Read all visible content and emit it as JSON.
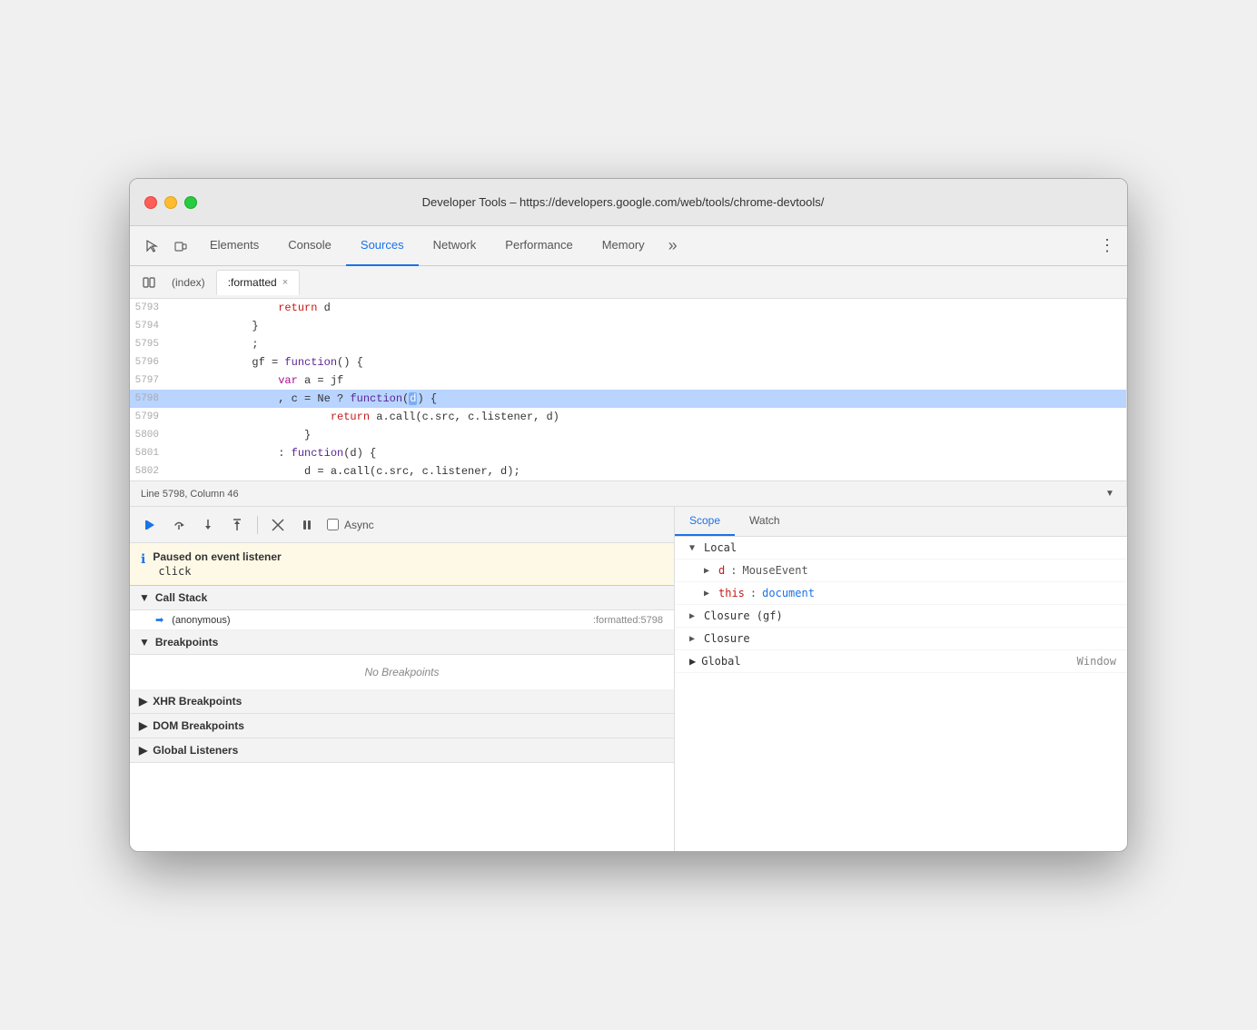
{
  "window": {
    "title": "Developer Tools – https://developers.google.com/web/tools/chrome-devtools/"
  },
  "tabs": {
    "items": [
      {
        "label": "Elements",
        "active": false
      },
      {
        "label": "Console",
        "active": false
      },
      {
        "label": "Sources",
        "active": true
      },
      {
        "label": "Network",
        "active": false
      },
      {
        "label": "Performance",
        "active": false
      },
      {
        "label": "Memory",
        "active": false
      }
    ],
    "more_label": "»",
    "menu_label": "⋮"
  },
  "file_tabs": {
    "index_label": "(index)",
    "formatted_label": ":formatted",
    "close_label": "×"
  },
  "code": {
    "lines": [
      {
        "num": "5793",
        "text": "                return d"
      },
      {
        "num": "5794",
        "text": "            }"
      },
      {
        "num": "5795",
        "text": "            ;"
      },
      {
        "num": "5796",
        "text": "            gf = function() {"
      },
      {
        "num": "5797",
        "text": "                var a = jf"
      },
      {
        "num": "5798",
        "text": "                , c = Ne ? function(d) {",
        "highlighted": true
      },
      {
        "num": "5799",
        "text": "                        return a.call(c.src, c.listener, d)"
      },
      {
        "num": "5800",
        "text": "                    }"
      },
      {
        "num": "5801",
        "text": "                : function(d) {"
      },
      {
        "num": "5802",
        "text": "                    d = a.call(c.src, c.listener, d);"
      }
    ],
    "status": "Line 5798, Column 46"
  },
  "debugger": {
    "resume_label": "▶",
    "step_over_label": "↻",
    "step_into_label": "↓",
    "step_out_label": "↑",
    "deactivate_label": "⤧",
    "pause_label": "⏸",
    "async_label": "Async"
  },
  "paused": {
    "title": "Paused on event listener",
    "detail": "click"
  },
  "call_stack": {
    "header": "Call Stack",
    "items": [
      {
        "name": "(anonymous)",
        "location": ":formatted:5798",
        "current": true
      }
    ]
  },
  "breakpoints": {
    "header": "Breakpoints",
    "empty_label": "No Breakpoints"
  },
  "xhr_breakpoints": {
    "header": "XHR Breakpoints"
  },
  "dom_breakpoints": {
    "header": "DOM Breakpoints"
  },
  "global_listeners": {
    "header": "Global Listeners"
  },
  "scope_tabs": [
    {
      "label": "Scope",
      "active": true
    },
    {
      "label": "Watch",
      "active": false
    }
  ],
  "scope": {
    "local_header": "Local",
    "local_items": [
      {
        "key": "d",
        "val": "MouseEvent",
        "expandable": true
      },
      {
        "key": "this",
        "val": "document",
        "expandable": true,
        "blue": true
      }
    ],
    "closure_gf_header": "Closure (gf)",
    "closure_header": "Closure",
    "global_header": "Global",
    "global_val": "Window"
  }
}
